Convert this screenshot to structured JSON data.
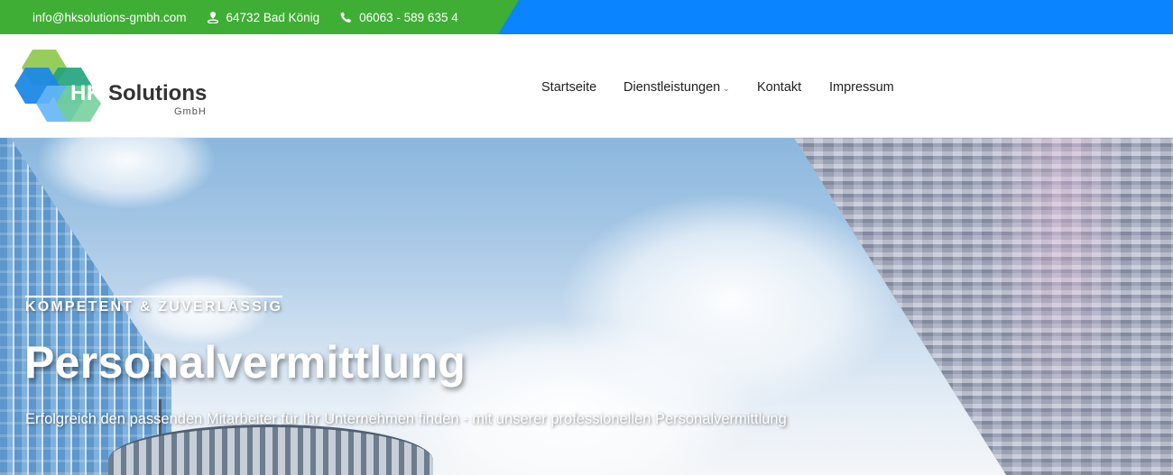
{
  "topbar": {
    "email": "info@hksolutions-gmbh.com",
    "address": "64732 Bad König",
    "phone": "06063 - 589 635 4",
    "icons": {
      "address": "location-pin-icon",
      "phone": "phone-icon"
    },
    "colors": {
      "green": "#3fae35",
      "blue": "#0a84ff"
    }
  },
  "logo": {
    "hk": "HK",
    "solutions": "Solutions",
    "gmbh": "GmbH"
  },
  "nav": {
    "items": [
      {
        "label": "Startseite"
      },
      {
        "label": "Dienstleistungen",
        "has_submenu": true
      },
      {
        "label": "Kontakt"
      },
      {
        "label": "Impressum"
      }
    ],
    "submenu_icon": "chevron-down-icon"
  },
  "hero": {
    "eyebrow": "KOMPETENT & ZUVERLÄSSIG",
    "title": "Personalvermittlung",
    "subtitle": "Erfolgreich den passenden Mitarbeiter für Ihr Unternehmen finden - mit unserer professionellen Personalvermittlung"
  }
}
